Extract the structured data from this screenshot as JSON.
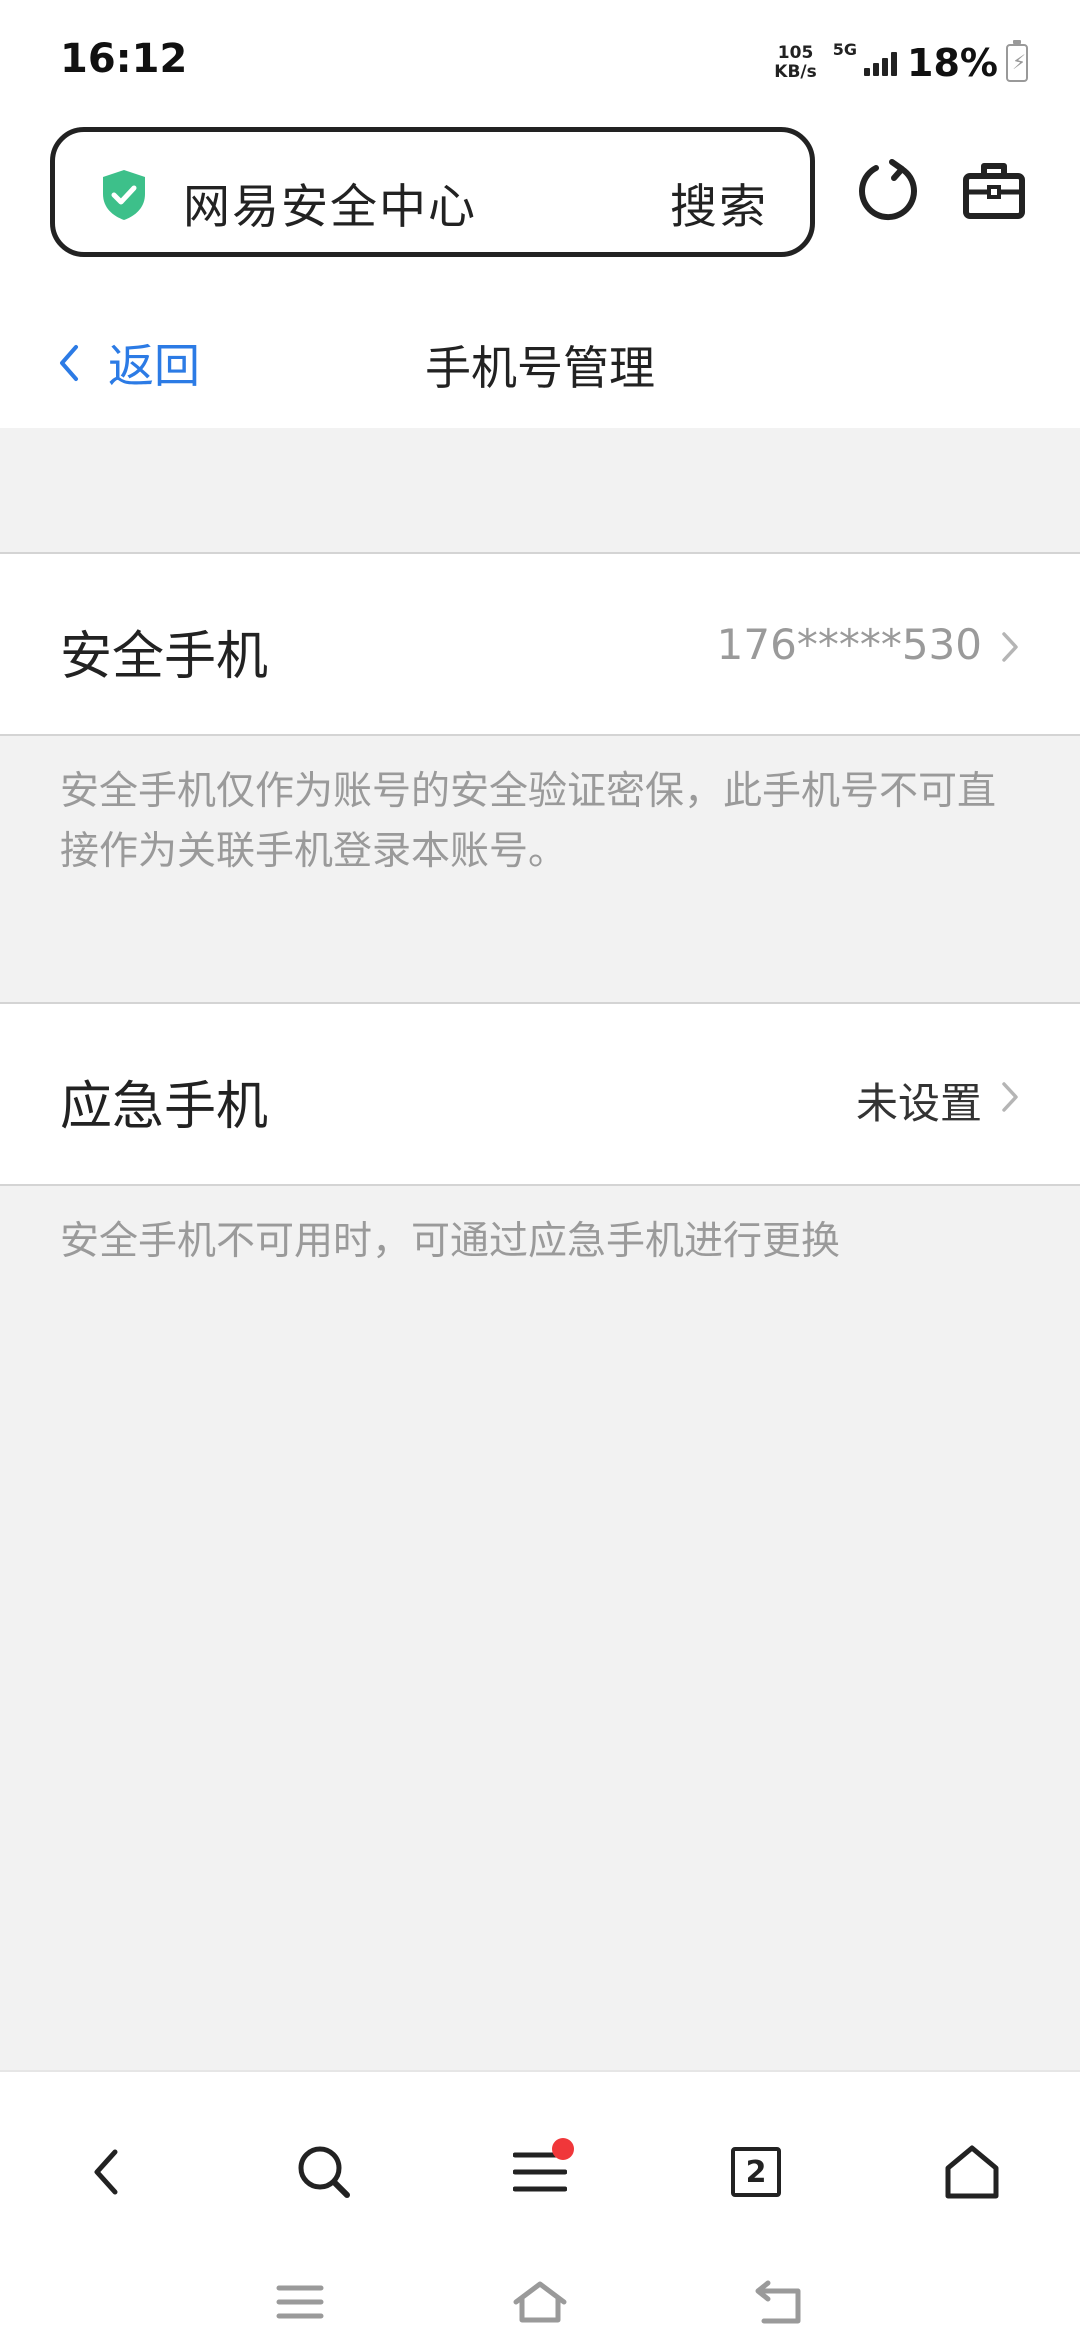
{
  "status_bar": {
    "time": "16:12",
    "net_speed_value": "105",
    "net_speed_unit": "KB/s",
    "network": "5G",
    "battery": "18%"
  },
  "search": {
    "site_name": "网易安全中心",
    "search_button": "搜索"
  },
  "header": {
    "back_label": "返回",
    "title": "手机号管理"
  },
  "security_phone": {
    "label": "安全手机",
    "value": "176*****530",
    "note": "安全手机仅作为账号的安全验证密保，此手机号不可直接作为关联手机登录本账号。"
  },
  "emergency_phone": {
    "label": "应急手机",
    "value": "未设置",
    "note": "安全手机不可用时，可通过应急手机进行更换"
  },
  "bottom_bar": {
    "tab_count": "2"
  },
  "colors": {
    "accent": "#2c7be5",
    "shield": "#3dc08a",
    "notification": "#f0373a"
  }
}
